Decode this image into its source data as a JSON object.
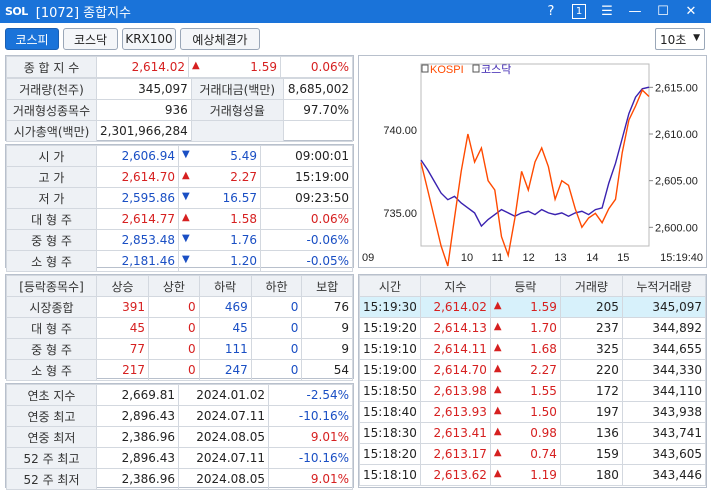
{
  "window": {
    "logo": "SOL",
    "title": "[1072] 종합지수",
    "help": "?",
    "num": "1"
  },
  "tabs": [
    {
      "label": "코스피"
    },
    {
      "label": "코스닥"
    },
    {
      "label": "KRX100"
    },
    {
      "label": "예상체결가"
    }
  ],
  "interval": {
    "value": "10초"
  },
  "summary": {
    "r1": {
      "label": "종 합 지 수",
      "value": "2,614.02",
      "change": "1.59",
      "rate": "0.06%"
    },
    "r2": {
      "l1": "거래량(천주)",
      "v1": "345,097",
      "l2": "거래대금(백만)",
      "v2": "8,685,002"
    },
    "r3": {
      "l1": "거래형성종목수",
      "v1": "936",
      "l2": "거래형성율",
      "v2": "97.70%"
    },
    "r4": {
      "l1": "시가총액(백만)",
      "v1": "2,301,966,284"
    }
  },
  "prices": [
    {
      "label": "시    가",
      "value": "2,606.94",
      "dir": "down",
      "change": "5.49",
      "extra": "09:00:01"
    },
    {
      "label": "고    가",
      "value": "2,614.70",
      "dir": "up",
      "change": "2.27",
      "extra": "15:19:00"
    },
    {
      "label": "저    가",
      "value": "2,595.86",
      "dir": "down",
      "change": "16.57",
      "extra": "09:23:50"
    },
    {
      "label": "대 형 주",
      "value": "2,614.77",
      "dir": "up",
      "change": "1.58",
      "extra": "0.06%"
    },
    {
      "label": "중 형 주",
      "value": "2,853.48",
      "dir": "down",
      "change": "1.76",
      "extra": "-0.06%"
    },
    {
      "label": "소 형 주",
      "value": "2,181.46",
      "dir": "down",
      "change": "1.20",
      "extra": "-0.05%"
    }
  ],
  "breadth": {
    "headers": [
      "[등락종목수]",
      "상승",
      "상한",
      "하락",
      "하한",
      "보합"
    ],
    "rows": [
      {
        "name": "시장종합",
        "up": "391",
        "uplim": "0",
        "down": "469",
        "dnlim": "0",
        "flat": "76"
      },
      {
        "name": "대 형 주",
        "up": "45",
        "uplim": "0",
        "down": "45",
        "dnlim": "0",
        "flat": "9"
      },
      {
        "name": "중 형 주",
        "up": "77",
        "uplim": "0",
        "down": "111",
        "dnlim": "0",
        "flat": "9"
      },
      {
        "name": "소 형 주",
        "up": "217",
        "uplim": "0",
        "down": "247",
        "dnlim": "0",
        "flat": "54"
      }
    ]
  },
  "yearly": [
    {
      "label": "연초  지수",
      "value": "2,669.81",
      "date": "2024.01.02",
      "rate": "-2.54%"
    },
    {
      "label": "연중  최고",
      "value": "2,896.43",
      "date": "2024.07.11",
      "rate": "-10.16%"
    },
    {
      "label": "연중  최저",
      "value": "2,386.96",
      "date": "2024.08.05",
      "rate": "9.01%"
    },
    {
      "label": "52 주 최고",
      "value": "2,896.43",
      "date": "2024.07.11",
      "rate": "-10.16%"
    },
    {
      "label": "52 주 최저",
      "value": "2,386.96",
      "date": "2024.08.05",
      "rate": "9.01%"
    }
  ],
  "ticks": {
    "headers": [
      "시간",
      "지수",
      "등락",
      "거래량",
      "누적거래량"
    ],
    "rows": [
      {
        "time": "15:19:30",
        "index": "2,614.02",
        "change": "1.59",
        "vol": "205",
        "cum": "345,097"
      },
      {
        "time": "15:19:20",
        "index": "2,614.13",
        "change": "1.70",
        "vol": "237",
        "cum": "344,892"
      },
      {
        "time": "15:19:10",
        "index": "2,614.11",
        "change": "1.68",
        "vol": "325",
        "cum": "344,655"
      },
      {
        "time": "15:19:00",
        "index": "2,614.70",
        "change": "2.27",
        "vol": "220",
        "cum": "344,330"
      },
      {
        "time": "15:18:50",
        "index": "2,613.98",
        "change": "1.55",
        "vol": "172",
        "cum": "344,110"
      },
      {
        "time": "15:18:40",
        "index": "2,613.93",
        "change": "1.50",
        "vol": "197",
        "cum": "343,938"
      },
      {
        "time": "15:18:30",
        "index": "2,613.41",
        "change": "0.98",
        "vol": "136",
        "cum": "343,741"
      },
      {
        "time": "15:18:20",
        "index": "2,613.17",
        "change": "0.74",
        "vol": "159",
        "cum": "343,605"
      },
      {
        "time": "15:18:10",
        "index": "2,613.62",
        "change": "1.19",
        "vol": "180",
        "cum": "343,446"
      }
    ]
  },
  "chart_data": {
    "type": "line",
    "series": [
      {
        "name": "KOSPI",
        "color": "#ff4a00"
      },
      {
        "name": "코스닥",
        "color": "#3a22b0"
      }
    ],
    "legend": "top-left",
    "y_left_ticks": [
      "740.00",
      "735.00"
    ],
    "y_right_ticks": [
      "2,615.00",
      "2,610.00",
      "2,605.00",
      "2,600.00"
    ],
    "x_ticks": [
      "09",
      "10",
      "11",
      "12",
      "13",
      "14",
      "15"
    ],
    "x_end_label": "15:19:40",
    "kospi_ylim": [
      2595.86,
      2614.7
    ],
    "kospi": [
      2606.94,
      2604.0,
      2601.0,
      2598.0,
      2595.86,
      2601.0,
      2606.0,
      2610.0,
      2607.0,
      2608.5,
      2605.0,
      2604.0,
      2599.0,
      2597.0,
      2601.0,
      2606.0,
      2604.0,
      2607.0,
      2608.5,
      2606.5,
      2603.0,
      2605.0,
      2604.5,
      2602.0,
      2600.0,
      2601.0,
      2601.5,
      2600.5,
      2602.0,
      2603.0,
      2608.0,
      2611.5,
      2613.0,
      2614.7,
      2614.02
    ],
    "kosdaq": [
      738.2,
      737.6,
      736.9,
      736.2,
      735.8,
      736.0,
      735.6,
      735.3,
      735.0,
      734.2,
      734.6,
      734.9,
      735.2,
      735.0,
      734.8,
      735.0,
      735.1,
      734.9,
      735.2,
      735.0,
      734.9,
      735.0,
      734.8,
      735.0,
      735.1,
      734.9,
      735.2,
      735.3,
      736.8,
      738.0,
      739.5,
      741.0,
      742.0,
      742.5,
      742.6
    ]
  },
  "colors": {
    "up": "#d62020",
    "down": "#1a4fc4",
    "title": "#1a73d9"
  }
}
